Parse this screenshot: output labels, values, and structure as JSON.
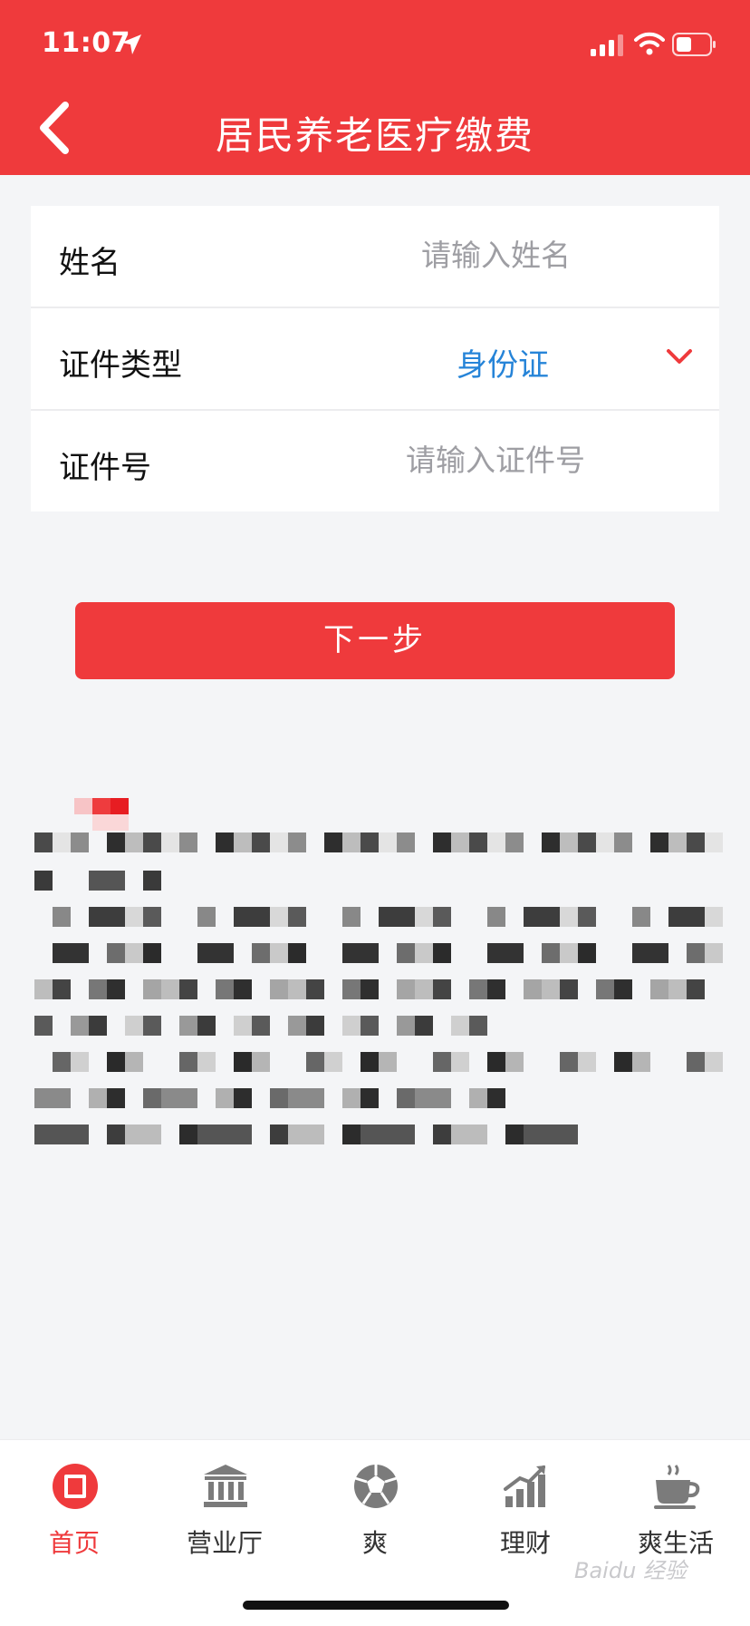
{
  "status_bar": {
    "time": "11:07"
  },
  "header": {
    "title": "居民养老医疗缴费"
  },
  "form": {
    "name": {
      "label": "姓名",
      "placeholder": "请输入姓名",
      "value": ""
    },
    "id_type": {
      "label": "证件类型",
      "value": "身份证"
    },
    "id_number": {
      "label": "证件号",
      "placeholder": "请输入证件号",
      "value": ""
    }
  },
  "next_button": {
    "label": "下一步"
  },
  "tabbar": {
    "items": [
      {
        "label": "首页",
        "icon": "home-icon",
        "active": true
      },
      {
        "label": "营业厅",
        "icon": "bank-icon",
        "active": false
      },
      {
        "label": "爽",
        "icon": "ball-icon",
        "active": false
      },
      {
        "label": "理财",
        "icon": "finance-chart-icon",
        "active": false
      },
      {
        "label": "爽生活",
        "icon": "coffee-cup-icon",
        "active": false
      }
    ]
  },
  "watermark": {
    "text": "Baidu 经验"
  },
  "colors": {
    "brand_red": "#ef3a3c",
    "link_blue": "#2684d8",
    "placeholder_gray": "#9e9ea3"
  }
}
